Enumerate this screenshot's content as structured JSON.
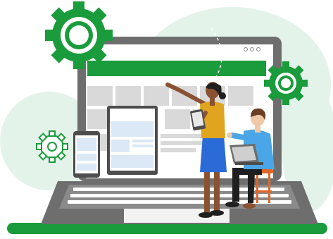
{
  "colors": {
    "brand_green": "#1a9b3c",
    "dark_green": "#157a30",
    "mint_blob": "#e3f3ea",
    "laptop_gray": "#6e6e6e",
    "laptop_dark": "#4d4d4d",
    "screen_cell": "#d9d9d9",
    "device_blue": "#dbe8f6",
    "shirt_yellow": "#e0a41f",
    "skirt_blue": "#2b6bd8",
    "shirt_lightblue": "#4aa6e6",
    "stool_orange": "#e0662a"
  },
  "icons": [
    "large-gear-icon",
    "right-gear-icon",
    "outline-gear-icon",
    "window-dots-icon"
  ],
  "scene": {
    "subjects": [
      "standing-woman-pointing",
      "seated-man-with-laptop"
    ],
    "devices": [
      "smartphone",
      "tablet",
      "laptop"
    ]
  }
}
